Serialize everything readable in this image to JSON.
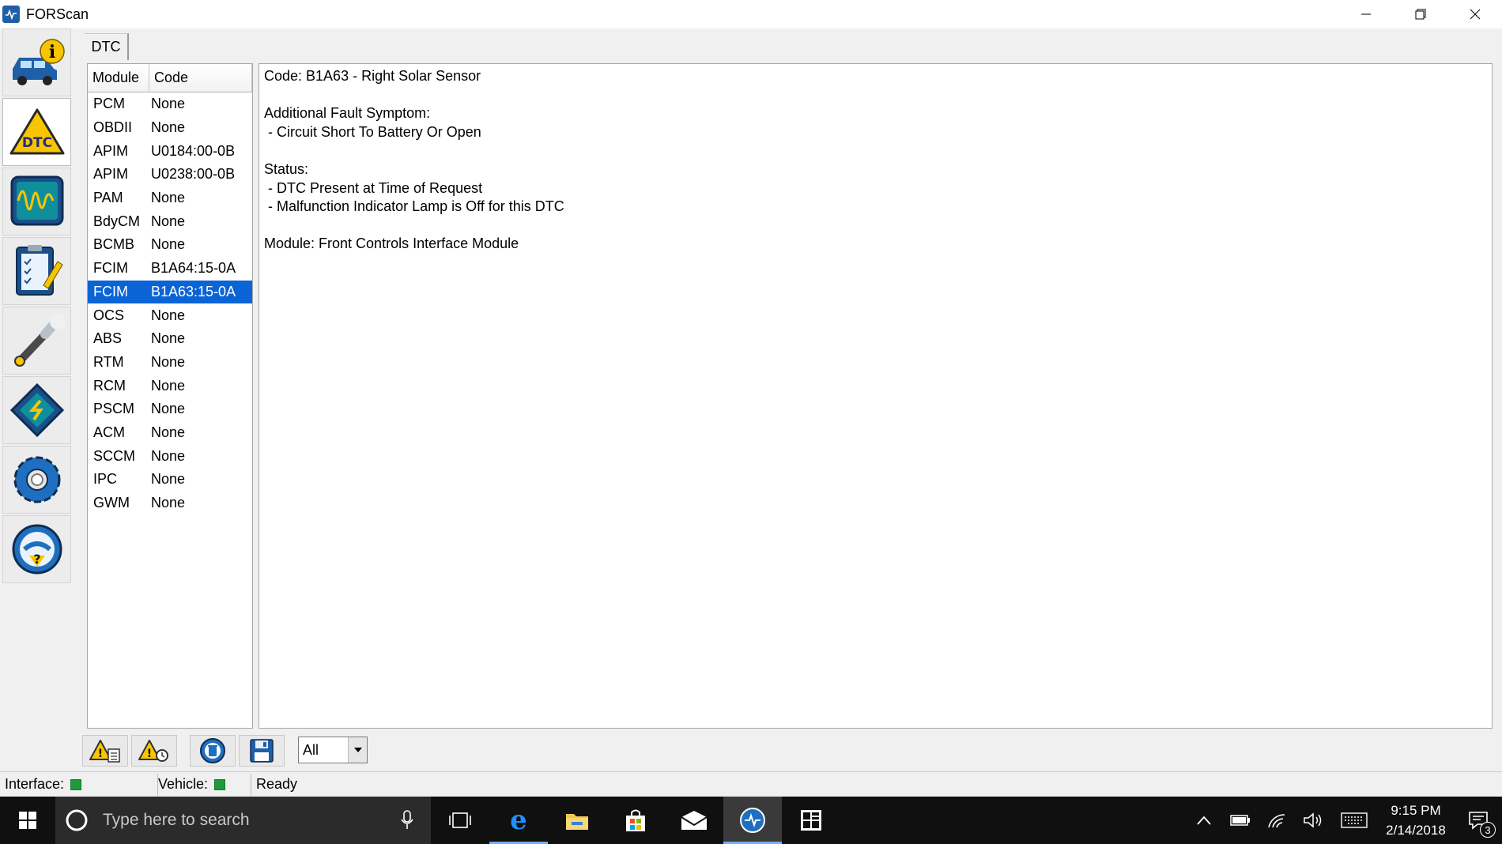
{
  "window": {
    "title": "FORScan"
  },
  "tab": {
    "label": "DTC"
  },
  "modules": {
    "header_module": "Module",
    "header_code": "Code",
    "rows": [
      {
        "module": "PCM",
        "code": "None"
      },
      {
        "module": "OBDII",
        "code": "None"
      },
      {
        "module": "APIM",
        "code": "U0184:00-0B"
      },
      {
        "module": "APIM",
        "code": "U0238:00-0B"
      },
      {
        "module": "PAM",
        "code": "None"
      },
      {
        "module": "BdyCM",
        "code": "None"
      },
      {
        "module": "BCMB",
        "code": "None"
      },
      {
        "module": "FCIM",
        "code": "B1A64:15-0A"
      },
      {
        "module": "FCIM",
        "code": "B1A63:15-0A"
      },
      {
        "module": "OCS",
        "code": "None"
      },
      {
        "module": "ABS",
        "code": "None"
      },
      {
        "module": "RTM",
        "code": "None"
      },
      {
        "module": "RCM",
        "code": "None"
      },
      {
        "module": "PSCM",
        "code": "None"
      },
      {
        "module": "ACM",
        "code": "None"
      },
      {
        "module": "SCCM",
        "code": "None"
      },
      {
        "module": "IPC",
        "code": "None"
      },
      {
        "module": "GWM",
        "code": "None"
      }
    ]
  },
  "detail": {
    "code_line": "Code: B1A63 - Right Solar Sensor",
    "symptom_title": "Additional Fault Symptom:",
    "symptom_line": " - Circuit Short To Battery Or Open",
    "status_title": "Status:",
    "status_line1": " - DTC Present at Time of Request",
    "status_line2": " - Malfunction Indicator Lamp is Off for this DTC",
    "module_line": "Module: Front Controls Interface Module"
  },
  "filter": {
    "selected": "All"
  },
  "status": {
    "interface_label": "Interface:",
    "vehicle_label": "Vehicle:",
    "state": "Ready",
    "led_color": "#1f9a3c"
  },
  "taskbar": {
    "search_placeholder": "Type here to search",
    "time": "9:15 PM",
    "date": "2/14/2018",
    "notification_count": "3"
  }
}
